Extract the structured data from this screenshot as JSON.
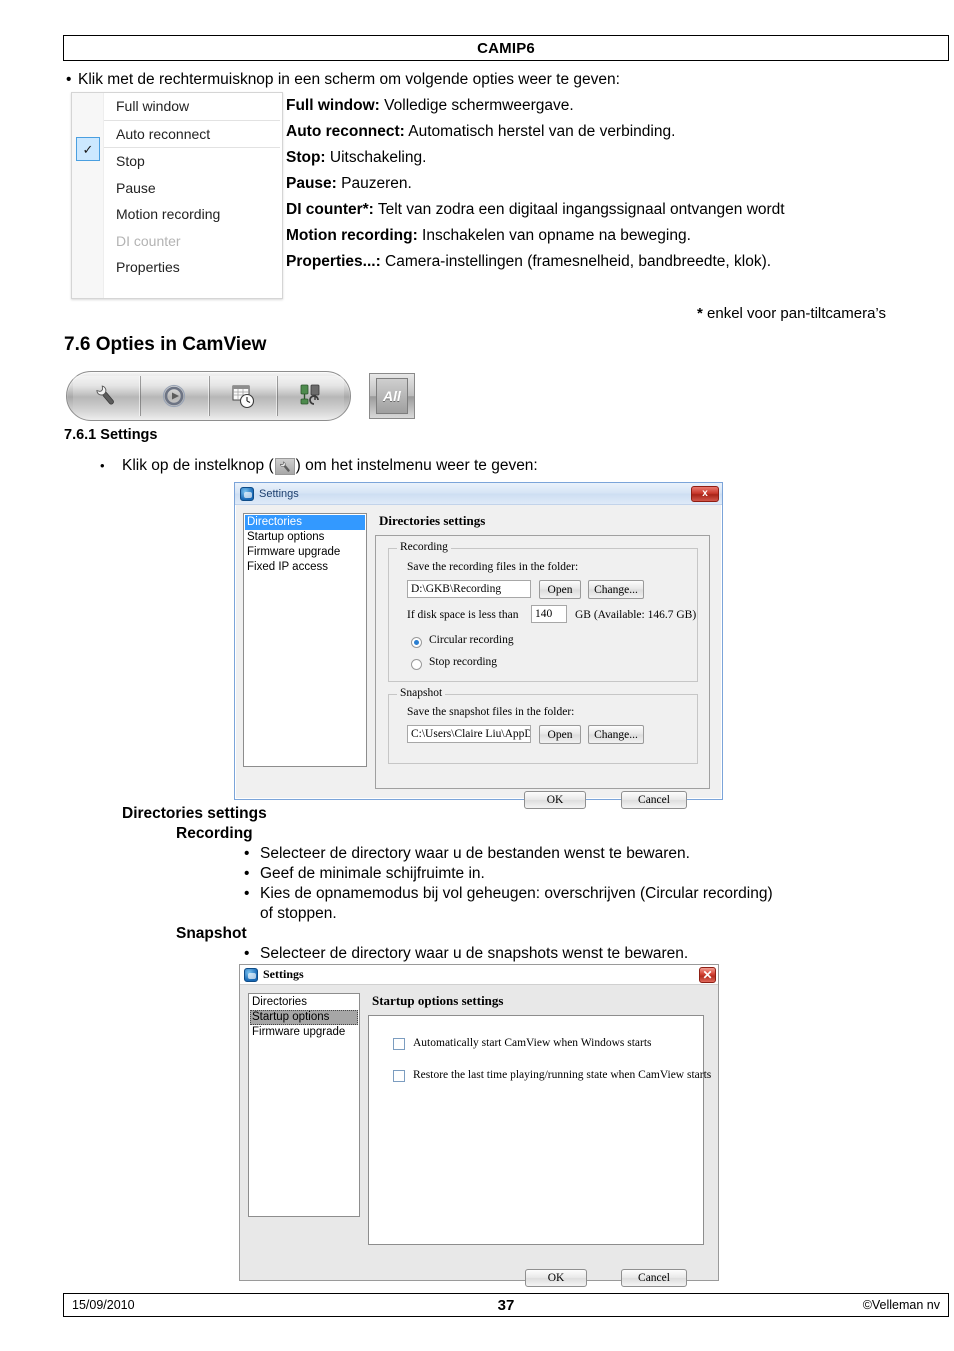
{
  "header": {
    "title": "CAMIP6"
  },
  "intro": {
    "bullet": "•",
    "text": "Klik met de rechtermuisknop in een scherm om volgende opties weer te geven:"
  },
  "context_menu": {
    "checked_item": "Auto reconnect",
    "check_glyph": "✓",
    "items": [
      {
        "label": "Full window",
        "disabled": false
      },
      {
        "label": "Auto reconnect",
        "disabled": false
      },
      {
        "label": "Stop",
        "disabled": false
      },
      {
        "label": "Pause",
        "disabled": false
      },
      {
        "label": "Motion recording",
        "disabled": false
      },
      {
        "label": "DI counter",
        "disabled": true
      },
      {
        "label": "Properties",
        "disabled": false
      }
    ]
  },
  "options": [
    {
      "term": "Full window:",
      "desc": " Volledige schermweergave."
    },
    {
      "term": "Auto reconnect:",
      "desc": " Automatisch herstel van de verbinding."
    },
    {
      "term": "Stop:",
      "desc": " Uitschakeling."
    },
    {
      "term": "Pause:",
      "desc": " Pauzeren."
    },
    {
      "term": "DI counter*:",
      "desc": " Telt van zodra een digitaal ingangssignaal ontvangen wordt"
    },
    {
      "term": "Motion recording:",
      "desc": " Inschakelen van opname na beweging."
    },
    {
      "term": "Properties...:",
      "desc": " Camera-instellingen (framesnelheid, bandbreedte, klok)."
    }
  ],
  "footnote": {
    "mark": "*",
    "text": " enkel voor pan-tiltcamera’s"
  },
  "headings": {
    "section": "7.6 Opties in CamView",
    "subsection": "7.6.1 Settings"
  },
  "toolbar": {
    "buttons": [
      {
        "name": "wrench-icon",
        "title": "Settings"
      },
      {
        "name": "play-record-icon",
        "title": "Play"
      },
      {
        "name": "schedule-icon",
        "title": "Schedule"
      },
      {
        "name": "connection-icon",
        "title": "Connection"
      }
    ],
    "all_button_label": "All"
  },
  "instruction": {
    "bullet": "•",
    "before": "Klik op de instelknop (",
    "after": ") om het instelmenu weer te geven:"
  },
  "dialog1": {
    "title": "Settings",
    "close_label": "x",
    "sidebar": {
      "items": [
        "Directories",
        "Startup options",
        "Firmware upgrade",
        "Fixed IP access"
      ],
      "selected": "Directories"
    },
    "panel_title": "Directories settings",
    "groups": {
      "recording": {
        "legend": "Recording",
        "folder_label": "Save the recording files in the folder:",
        "folder_value": "D:\\GKB\\Recording",
        "open_label": "Open",
        "change_label": "Change...",
        "disk_label": "If disk space is less than",
        "disk_value": "140",
        "disk_suffix": "GB (Available: 146.7 GB)",
        "radio_circular": "Circular recording",
        "radio_stop": "Stop recording",
        "radio_selected": "Circular recording"
      },
      "snapshot": {
        "legend": "Snapshot",
        "folder_label": "Save the snapshot files in the folder:",
        "folder_value": "C:\\Users\\Claire Liu\\AppData\\Roaming\\C:",
        "open_label": "Open",
        "change_label": "Change..."
      }
    },
    "ok_label": "OK",
    "cancel_label": "Cancel"
  },
  "explanations": {
    "level1": "Directories settings",
    "recording_heading": "Recording",
    "recording_items": [
      "Selecteer de directory waar u de bestanden wenst te bewaren.",
      "Geef de minimale schijfruimte in.",
      "Kies de opnamemodus bij vol geheugen: overschrijven (Circular recording)"
    ],
    "recording_cont": "of stoppen.",
    "snapshot_heading": "Snapshot",
    "snapshot_items": [
      "Selecteer de directory waar u de snapshots wenst te bewaren."
    ],
    "bullet": "•"
  },
  "dialog2": {
    "title": "Settings",
    "close_label": "✕",
    "sidebar": {
      "items": [
        "Directories",
        "Startup options",
        "Firmware upgrade"
      ],
      "selected": "Startup options"
    },
    "panel_title": "Startup options settings",
    "checkboxes": [
      {
        "label": "Automatically start CamView when Windows starts",
        "checked": false
      },
      {
        "label": "Restore the last time playing/running state when CamView starts",
        "checked": false
      }
    ],
    "ok_label": "OK",
    "cancel_label": "Cancel"
  },
  "footer": {
    "date": "15/09/2010",
    "page": "37",
    "copyright": "©Velleman nv"
  }
}
